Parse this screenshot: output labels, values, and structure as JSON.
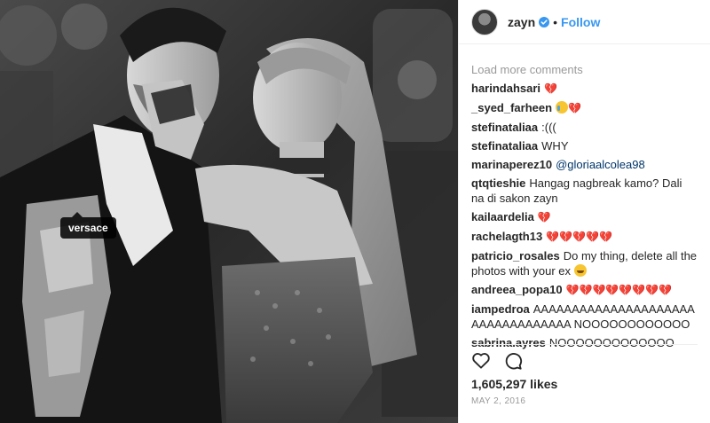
{
  "photo": {
    "tag_label": "versace"
  },
  "header": {
    "username": "zayn",
    "follow_label": "Follow",
    "separator": "•"
  },
  "comments": {
    "load_more": "Load more comments",
    "items": [
      {
        "user": "harindahsari",
        "text": "",
        "emoji": "broken-heart"
      },
      {
        "user": "_syed_farheen",
        "text": "",
        "emoji": "crying-face broken-heart"
      },
      {
        "user": "stefinataliaa",
        "text": ":((("
      },
      {
        "user": "stefinataliaa",
        "text": "WHY"
      },
      {
        "user": "marinaperez10",
        "text": "",
        "mention": "@gloriaalcolea98"
      },
      {
        "user": "qtqtieshie",
        "text": "Hangag nagbreak kamo? Dali na di sakon zayn"
      },
      {
        "user": "kailaardelia",
        "text": "",
        "emoji": "broken-heart"
      },
      {
        "user": "rachelagth13",
        "text": "",
        "emoji": "broken-heart x5"
      },
      {
        "user": "patricio_rosales",
        "text": "Do my thing, delete all the photos with your ex",
        "emoji": "grinning-face"
      },
      {
        "user": "andreea_popa10",
        "text": "",
        "emoji": "broken-heart x8"
      },
      {
        "user": "iampedroa",
        "text": "AAAAAAAAAAAAAAAAAAAAAAAAAAAAAAAAAA NOOOOOOOOOOOO"
      },
      {
        "user": "sabrina.ayres",
        "text": "NOOOOOOOOOOOOO"
      }
    ]
  },
  "footer": {
    "likes": "1,605,297 likes",
    "date": "MAY 2, 2016"
  },
  "icons": {
    "like": "heart-outline-icon",
    "comment": "speech-bubble-icon",
    "verified": "verified-badge-icon"
  },
  "colors": {
    "link_blue": "#3897f0",
    "mention": "#003569",
    "muted": "#999999",
    "text": "#262626"
  }
}
